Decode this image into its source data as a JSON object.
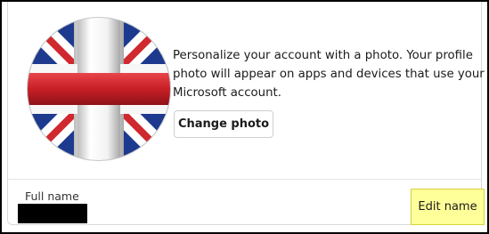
{
  "profile": {
    "intro_text": "Personalize your account with a photo. Your profile photo will appear on apps and devices that use your Microsoft account.",
    "change_photo_label": "Change photo"
  },
  "full_name": {
    "label": "Full name",
    "value_redacted": true,
    "edit_label": "Edit name"
  },
  "colors": {
    "highlight": "#ffff99",
    "flag_red": "#d0282f",
    "flag_blue": "#1d3a8e"
  },
  "icons": {
    "avatar": "union-jack-avatar"
  }
}
